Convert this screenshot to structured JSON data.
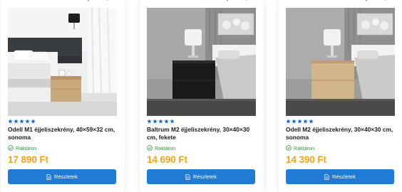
{
  "colors": {
    "accent": "#1f7bd6",
    "price": "#f5a21d",
    "stock": "#2a9a3b",
    "star": "#1f6fcc"
  },
  "icons": {
    "compare": "compare-arrows-icon",
    "wishlist": "heart-icon",
    "rating": "star-icon",
    "stock": "check-circle-icon",
    "details": "document-icon"
  },
  "products": [
    {
      "title": "Odell M1 éjjeliszekrény, 40×59×32 cm, sonoma",
      "rating": 5,
      "stock": "Raktáron",
      "price": "17 890 Ft",
      "button": "Részletek"
    },
    {
      "title": "Baltrum M2 éjjeliszekrény, 30×40×30 cm, fekete",
      "rating": 5,
      "stock": "Raktáron",
      "price": "14 690 Ft",
      "button": "Részletek"
    },
    {
      "title": "Odell M2 éjjeliszekrény, 30×40×30 cm, sonoma",
      "rating": 5,
      "stock": "Raktáron",
      "price": "14 390 Ft",
      "button": "Részletek"
    }
  ]
}
